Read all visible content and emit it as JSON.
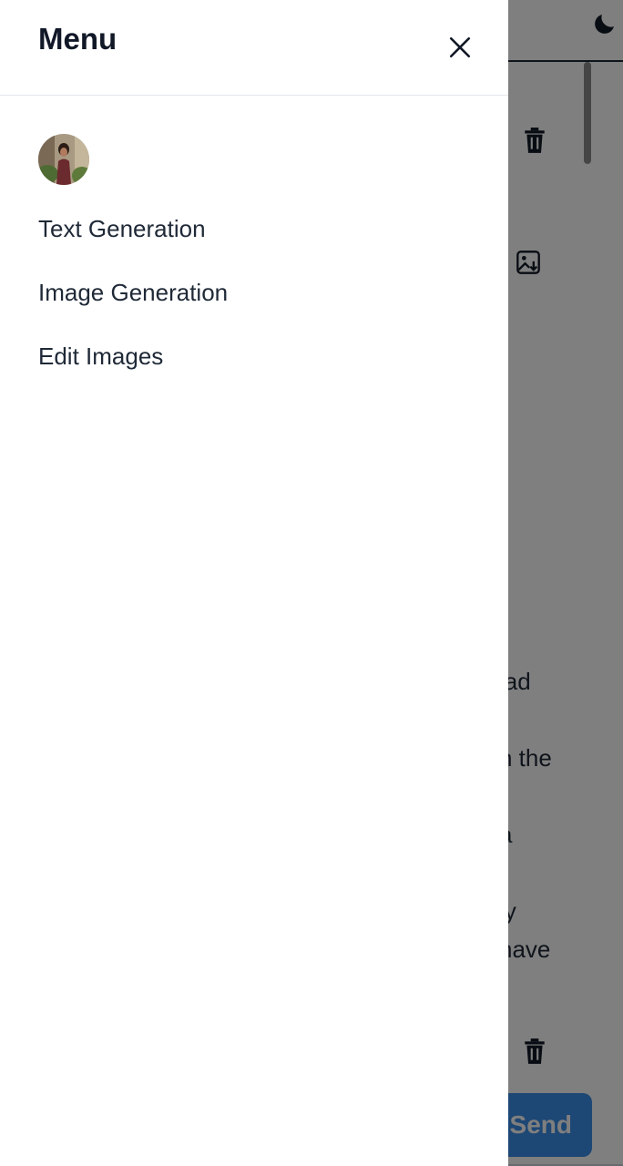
{
  "header": {
    "theme_icon": "moon-icon"
  },
  "chat": {
    "fragments": [
      "lad",
      "n the",
      "a",
      "ly",
      "have"
    ],
    "icons": [
      "trash-icon",
      "image-download-icon",
      "trash-icon"
    ]
  },
  "input": {
    "send_label": "Send"
  },
  "drawer": {
    "title": "Menu",
    "close_icon": "close-icon",
    "items": [
      {
        "label": "Text Generation"
      },
      {
        "label": "Image Generation"
      },
      {
        "label": "Edit Images"
      }
    ]
  },
  "colors": {
    "overlay": "#000000",
    "send_button": "#3b8ee8",
    "title_text": "#111827"
  }
}
